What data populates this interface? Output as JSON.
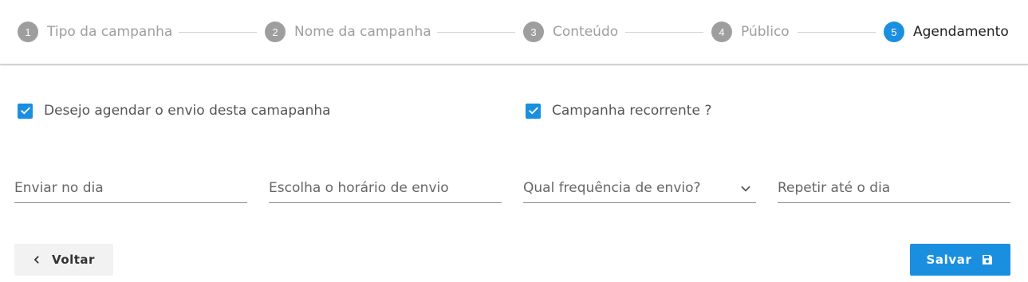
{
  "stepper": {
    "steps": [
      {
        "number": "1",
        "label": "Tipo da campanha"
      },
      {
        "number": "2",
        "label": "Nome da campanha"
      },
      {
        "number": "3",
        "label": "Conteúdo"
      },
      {
        "number": "4",
        "label": "Público"
      },
      {
        "number": "5",
        "label": "Agendamento"
      }
    ],
    "active_step": 5
  },
  "options": {
    "schedule": {
      "label": "Desejo agendar o envio desta camapanha",
      "checked": true
    },
    "recurring": {
      "label": "Campanha recorrente ?",
      "checked": true
    }
  },
  "fields": {
    "send_date": {
      "placeholder": "Enviar no dia"
    },
    "send_time": {
      "placeholder": "Escolha o horário de envio"
    },
    "frequency": {
      "placeholder": "Qual frequência de envio?"
    },
    "repeat_until": {
      "placeholder": "Repetir até o dia"
    }
  },
  "actions": {
    "back_label": "Voltar",
    "save_label": "Salvar"
  },
  "colors": {
    "accent": "#1a8fe0",
    "inactive_step": "#9e9e9e"
  },
  "icons": {
    "back": "chevron-left-icon",
    "save": "floppy-disk-icon",
    "dropdown": "chevron-down-icon",
    "check": "check-icon"
  }
}
